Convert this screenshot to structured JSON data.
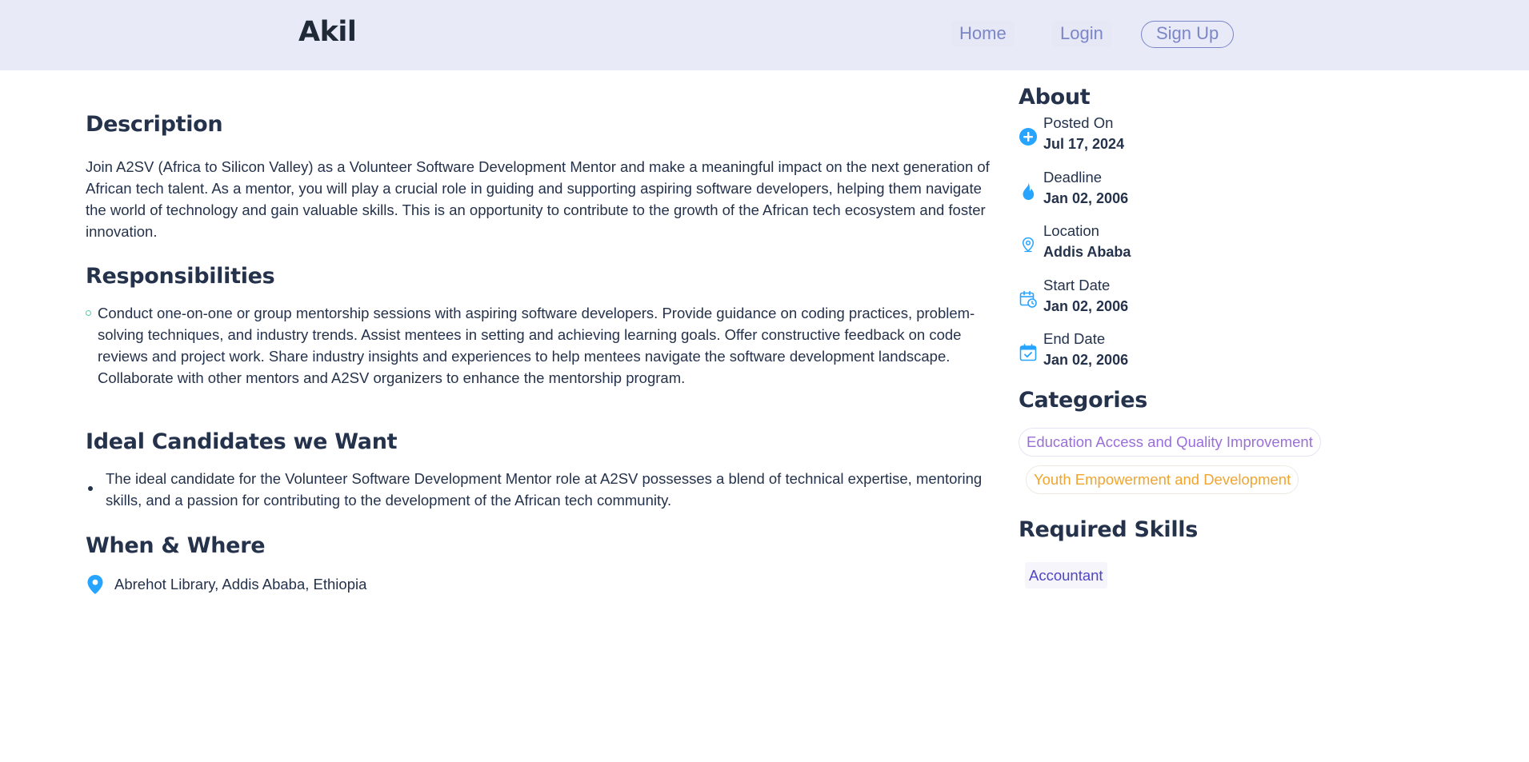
{
  "navbar": {
    "brand": "Akil",
    "links": {
      "home": "Home",
      "login": "Login",
      "signup": "Sign Up"
    }
  },
  "main": {
    "description": {
      "title": "Description",
      "text": "Join A2SV (Africa to Silicon Valley) as a Volunteer Software Development Mentor and make a meaningful impact on the next generation of African tech talent. As a mentor, you will play a crucial role in guiding and supporting aspiring software developers, helping them navigate the world of technology and gain valuable skills. This is an opportunity to contribute to the growth of the African tech ecosystem and foster innovation."
    },
    "responsibilities": {
      "title": "Responsibilities",
      "items": [
        "Conduct one-on-one or group mentorship sessions with aspiring software developers. Provide guidance on coding practices, problem-solving techniques, and industry trends. Assist mentees in setting and achieving learning goals. Offer constructive feedback on code reviews and project work. Share industry insights and experiences to help mentees navigate the software development landscape. Collaborate with other mentors and A2SV organizers to enhance the mentorship program."
      ]
    },
    "ideal_candidates": {
      "title": "Ideal Candidates we Want",
      "items": [
        "The ideal candidate for the Volunteer Software Development Mentor role at A2SV possesses a blend of technical expertise, mentoring skills, and a passion for contributing to the development of the African tech community."
      ]
    },
    "when_where": {
      "title": "When & Where",
      "location": "Abrehot Library, Addis Ababa, Ethiopia"
    }
  },
  "sidebar": {
    "about": {
      "title": "About",
      "items": [
        {
          "label": "Posted On",
          "value": "Jul 17, 2024",
          "icon": "plus-circle-icon"
        },
        {
          "label": "Deadline",
          "value": "Jan 02, 2006",
          "icon": "fire-icon"
        },
        {
          "label": "Location",
          "value": "Addis Ababa",
          "icon": "location-pin-icon"
        },
        {
          "label": "Start Date",
          "value": "Jan 02, 2006",
          "icon": "calendar-clock-icon"
        },
        {
          "label": "End Date",
          "value": "Jan 02, 2006",
          "icon": "calendar-check-icon"
        }
      ]
    },
    "categories": {
      "title": "Categories",
      "items": [
        {
          "label": "Education Access and Quality Improvement",
          "color": "#9b6fd9"
        },
        {
          "label": "Youth Empowerment and Development",
          "color": "#f0a52e"
        }
      ]
    },
    "required_skills": {
      "title": "Required Skills",
      "items": [
        "Accountant"
      ]
    }
  },
  "colors": {
    "accent": "#26a4ff",
    "nav_bg": "#e8eaf8",
    "nav_link": "#7b86c9",
    "heading": "#25324b"
  }
}
